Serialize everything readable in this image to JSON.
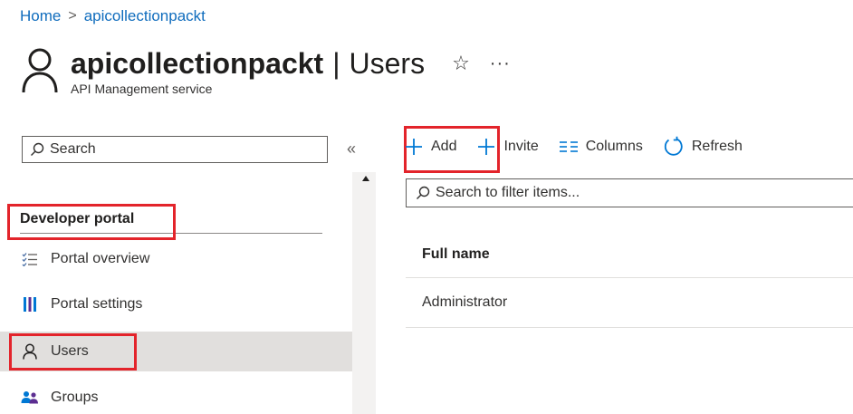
{
  "breadcrumb": {
    "home": "Home",
    "separator": ">",
    "current": "apicollectionpackt"
  },
  "header": {
    "resource_name": "apicollectionpackt",
    "separator": "|",
    "page": "Users",
    "subtitle": "API Management service",
    "icons": [
      "user-outline-icon",
      "star-icon",
      "more-icon"
    ]
  },
  "sidebar": {
    "search_placeholder": "Search",
    "collapse_label": "«",
    "section_title": "Developer portal",
    "items": [
      {
        "label": "Portal overview",
        "icon": "checklist-icon",
        "selected": false
      },
      {
        "label": "Portal settings",
        "icon": "settings-bars-icon",
        "selected": false
      },
      {
        "label": "Users",
        "icon": "user-icon",
        "selected": true
      },
      {
        "label": "Groups",
        "icon": "groups-icon",
        "selected": false
      }
    ]
  },
  "toolbar": {
    "add_label": "Add",
    "invite_label": "Invite",
    "columns_label": "Columns",
    "refresh_label": "Refresh"
  },
  "filter": {
    "placeholder": "Search to filter items..."
  },
  "table": {
    "columns": [
      "Full name"
    ],
    "rows": [
      {
        "full_name": "Administrator"
      }
    ]
  },
  "colors": {
    "link": "#0f6cbd",
    "accent": "#0078d4",
    "highlight": "#e3242b",
    "selected_bg": "#e1dfdd"
  }
}
